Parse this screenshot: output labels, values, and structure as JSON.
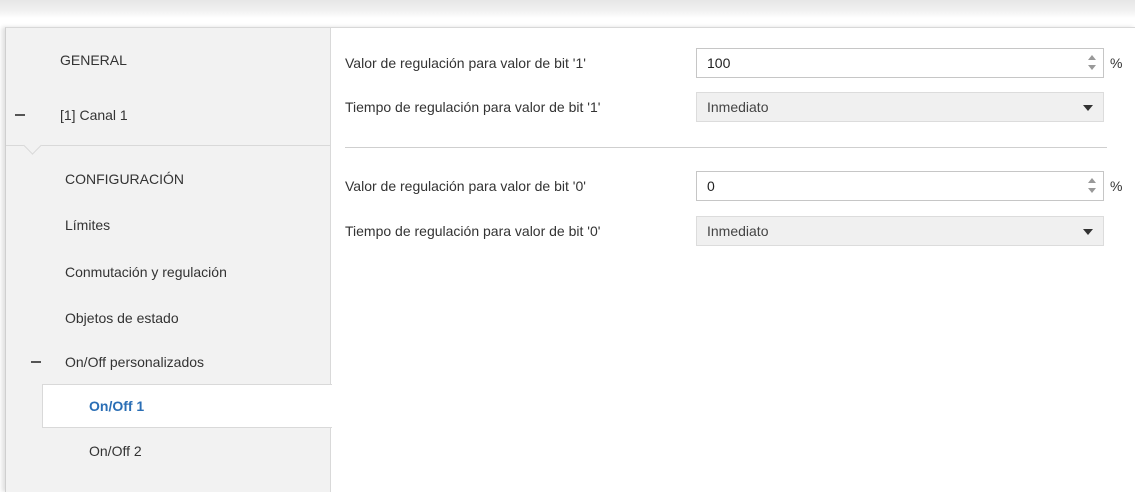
{
  "sidebar": {
    "items": [
      {
        "label": "GENERAL"
      },
      {
        "label": "[1] Canal 1"
      },
      {
        "label": "CONFIGURACIÓN"
      },
      {
        "label": "Límites"
      },
      {
        "label": "Conmutación y regulación"
      },
      {
        "label": "Objetos de estado"
      },
      {
        "label": "On/Off personalizados"
      },
      {
        "label": "On/Off 1"
      },
      {
        "label": "On/Off 2"
      }
    ],
    "selected": "On/Off 1"
  },
  "main": {
    "bit1": {
      "value_label": "Valor de regulación para valor de bit '1'",
      "value": "100",
      "value_unit": "%",
      "time_label": "Tiempo de regulación para valor de bit '1'",
      "time_value": "Inmediato"
    },
    "bit0": {
      "value_label": "Valor de regulación para valor de bit '0'",
      "value": "0",
      "value_unit": "%",
      "time_label": "Tiempo de regulación para valor de bit '0'",
      "time_value": "Inmediato"
    }
  },
  "icons": [
    "collapse-minus-icon",
    "spin-up-icon",
    "spin-down-icon",
    "dropdown-caret-icon"
  ]
}
